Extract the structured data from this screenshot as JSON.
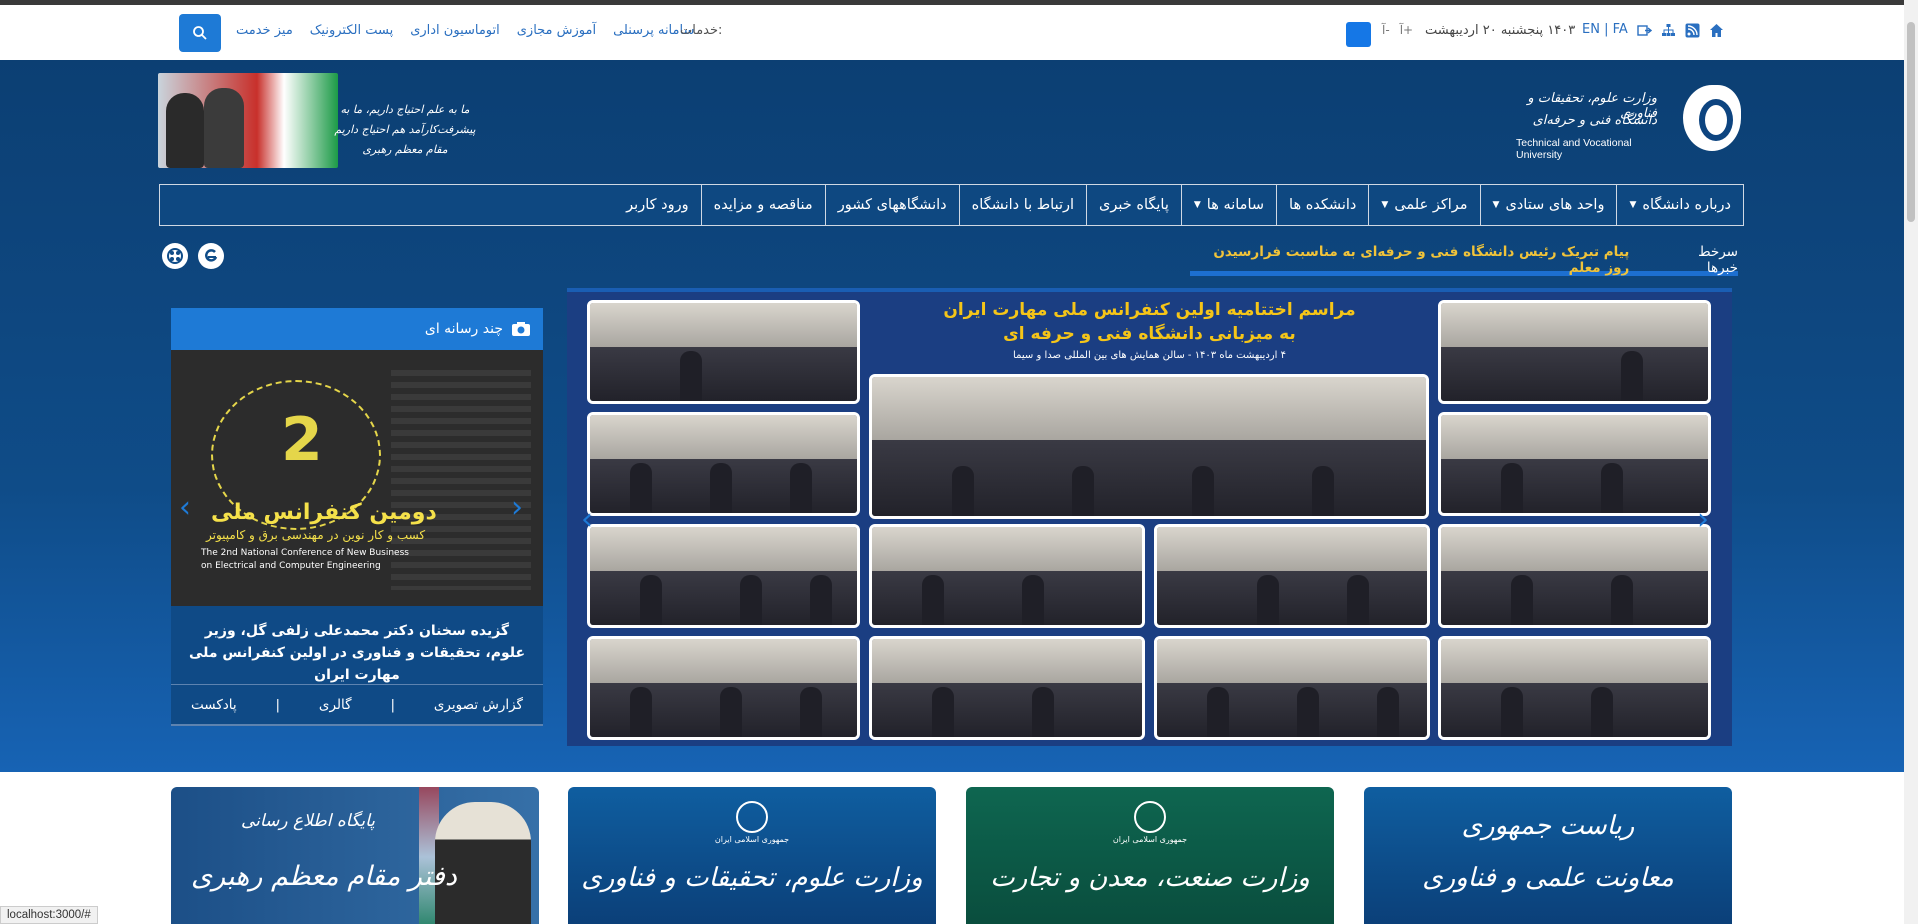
{
  "util": {
    "services_label": "خدمات:",
    "services": [
      "میز خدمت",
      "پست الکترونیک",
      "اتوماسیون اداری",
      "آموزش مجازی",
      "سامانه پرسنلی"
    ],
    "font_plus": "آ+",
    "font_minus": "آ-",
    "date": "۱۴۰۳ پنجشنبه ۲۰ اردیبهشت",
    "lang": "EN | FA",
    "icons": [
      "home-icon",
      "rss-icon",
      "sitemap-icon",
      "login-icon",
      "search-icon"
    ]
  },
  "header": {
    "quote_line1": "ما به علم احتیاج داریم، ما به پیشرفت‌کارآمد هم احتیاج داریم",
    "quote_line2": "مقام معظم رهبری",
    "logo_fa1": "وزارت علوم، تحقیقات و فناوری",
    "logo_fa2": "دانشگاه فنی و حرفه‌ای",
    "logo_en": "Technical and Vocational University"
  },
  "nav": [
    {
      "label": "درباره دانشگاه",
      "caret": true
    },
    {
      "label": "واحد های ستادی",
      "caret": true
    },
    {
      "label": "مراکز علمی",
      "caret": true
    },
    {
      "label": "دانشکده ها",
      "caret": false
    },
    {
      "label": "سامانه ها",
      "caret": true
    },
    {
      "label": "پایگاه خبری",
      "caret": false
    },
    {
      "label": "ارتباط با دانشگاه",
      "caret": false
    },
    {
      "label": "دانشگاههای کشور",
      "caret": false
    },
    {
      "label": "مناقصه و مزایده",
      "caret": false
    },
    {
      "label": "ورود کاربر",
      "caret": false
    }
  ],
  "ticker": {
    "label": "سرخط خبرها",
    "text": "پیام تبریک رئیس دانشگاه فنی و حرفه‌ای به مناسبت فرارسیدن روز معلم"
  },
  "slider": {
    "title1": "مراسم اختتامیه اولین کنفرانس ملی مهارت ایران",
    "title2": "به میزبانی دانشگاه فنی و حرفه ای",
    "title3": "۴ اردیبهشت ماه ۱۴۰۳ - سالن همایش های بین المللی صدا و سیما",
    "prev": "‹",
    "next": "›"
  },
  "media": {
    "heading": "چند رسانه ای",
    "poster_num": "2",
    "poster_title": "دومین کنفرانس ملی",
    "poster_sub": "کسب و کار نوین در مهندسی برق و کامپیوتر",
    "poster_en1": "The 2nd National Conference of New Business",
    "poster_en2": "on Electrical and Computer Engineering",
    "caption": "گزیده سخنان دکتر محمدعلی زلفی گل، وزیر علوم، تحقیقات و فناوری در اولین کنفرانس ملی مهارت ایران",
    "tabs": [
      "گزارش تصویری",
      "|",
      "گالری",
      "|",
      "پادکست"
    ]
  },
  "banners": {
    "b1_line1": "پایگاه اطلاع رسانی",
    "b1_line2": "دفتر مقام معظم رهبری",
    "b2_sub": "جمهوری اسلامی ایران",
    "b2_line": "وزارت علوم، تحقیقات و فناوری",
    "b3_sub": "جمهوری اسلامی ایران",
    "b3_line": "وزارت صنعت، معدن و تجارت",
    "b4_line1": "ریاست جمهوری",
    "b4_line2": "معاونت علمی و فناوری"
  },
  "status": "localhost:3000/#",
  "colors": {
    "header_blue": "#0f4c88",
    "accent": "#1e7ad6",
    "ticker": "#f0c33a"
  }
}
